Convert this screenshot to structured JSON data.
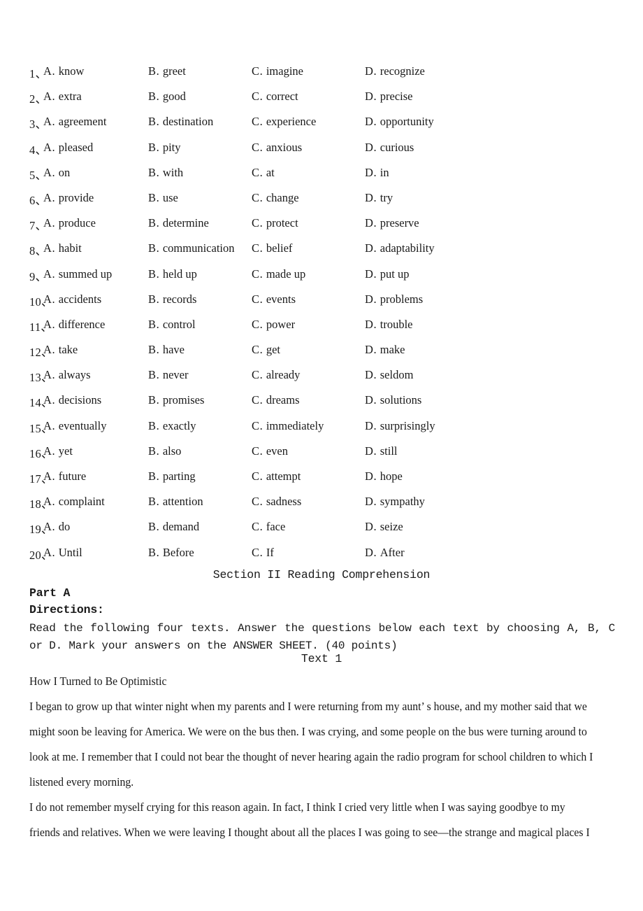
{
  "cloze": {
    "marker_a": "A.",
    "marker_b": "B.",
    "marker_c": "C.",
    "marker_d": "D.",
    "rows": [
      {
        "num": "1、",
        "a": "know",
        "b": "greet",
        "c": "imagine",
        "d": "recognize"
      },
      {
        "num": "2、",
        "a": "extra",
        "b": "good",
        "c": "correct",
        "d": "precise"
      },
      {
        "num": "3、",
        "a": "agreement",
        "b": "destination",
        "c": "experience",
        "d": "opportunity"
      },
      {
        "num": "4、",
        "a": "pleased",
        "b": "pity",
        "c": "anxious",
        "d": "curious"
      },
      {
        "num": "5、",
        "a": "on",
        "b": "with",
        "c": "at",
        "d": "in"
      },
      {
        "num": "6、",
        "a": "provide",
        "b": "use",
        "c": "change",
        "d": "try"
      },
      {
        "num": "7、",
        "a": "produce",
        "b": "determine",
        "c": "protect",
        "d": "preserve"
      },
      {
        "num": "8、",
        "a": "habit",
        "b": "communication",
        "c": "belief",
        "d": "adaptability"
      },
      {
        "num": "9、",
        "a": "summed up",
        "b": "held up",
        "c": "made up",
        "d": "put up"
      },
      {
        "num": "10、",
        "a": "accidents",
        "b": "records",
        "c": "events",
        "d": "problems"
      },
      {
        "num": "11、",
        "a": "difference",
        "b": "control",
        "c": "power",
        "d": "trouble"
      },
      {
        "num": "12、",
        "a": "take",
        "b": "have",
        "c": "get",
        "d": "make"
      },
      {
        "num": "13、",
        "a": "always",
        "b": "never",
        "c": "already",
        "d": "seldom"
      },
      {
        "num": "14、",
        "a": "decisions",
        "b": "promises",
        "c": "dreams",
        "d": "solutions"
      },
      {
        "num": "15、",
        "a": "eventually",
        "b": "exactly",
        "c": "immediately",
        "d": "surprisingly"
      },
      {
        "num": "16、",
        "a": "yet",
        "b": "also",
        "c": "even",
        "d": "still"
      },
      {
        "num": "17、",
        "a": "future",
        "b": "parting",
        "c": "attempt",
        "d": "hope"
      },
      {
        "num": "18、",
        "a": "complaint",
        "b": "attention",
        "c": "sadness",
        "d": "sympathy"
      },
      {
        "num": "19、",
        "a": "do",
        "b": "demand",
        "c": "face",
        "d": "seize"
      },
      {
        "num": "20、",
        "a": "Until",
        "b": "Before",
        "c": "If",
        "d": "After"
      }
    ]
  },
  "section": {
    "title": "Section II Reading Comprehension",
    "part_label": "Part A",
    "directions_label": "Directions:",
    "directions_body": "Read the following four texts. Answer the questions below each text by choosing A, B, C or D. Mark your answers on the ANSWER SHEET. (40 points)",
    "text_label": "Text 1"
  },
  "passage": {
    "title": "How I Turned to Be Optimistic",
    "lines": [
      "I began to grow up that winter night when my parents and I were returning from my aunt’ s house, and my mother said that we",
      "might soon be leaving for America. We were on the bus then. I was crying, and some people on the bus were turning around to",
      "look at me. I remember that I could not bear the thought of never hearing again the radio program for school children to which I",
      "listened every morning.",
      "I do not remember myself crying for this reason again. In fact, I think I cried very little when I was saying goodbye to my",
      "friends and relatives. When we were leaving I thought about all the places I was going to see—the strange and magical places I"
    ]
  }
}
